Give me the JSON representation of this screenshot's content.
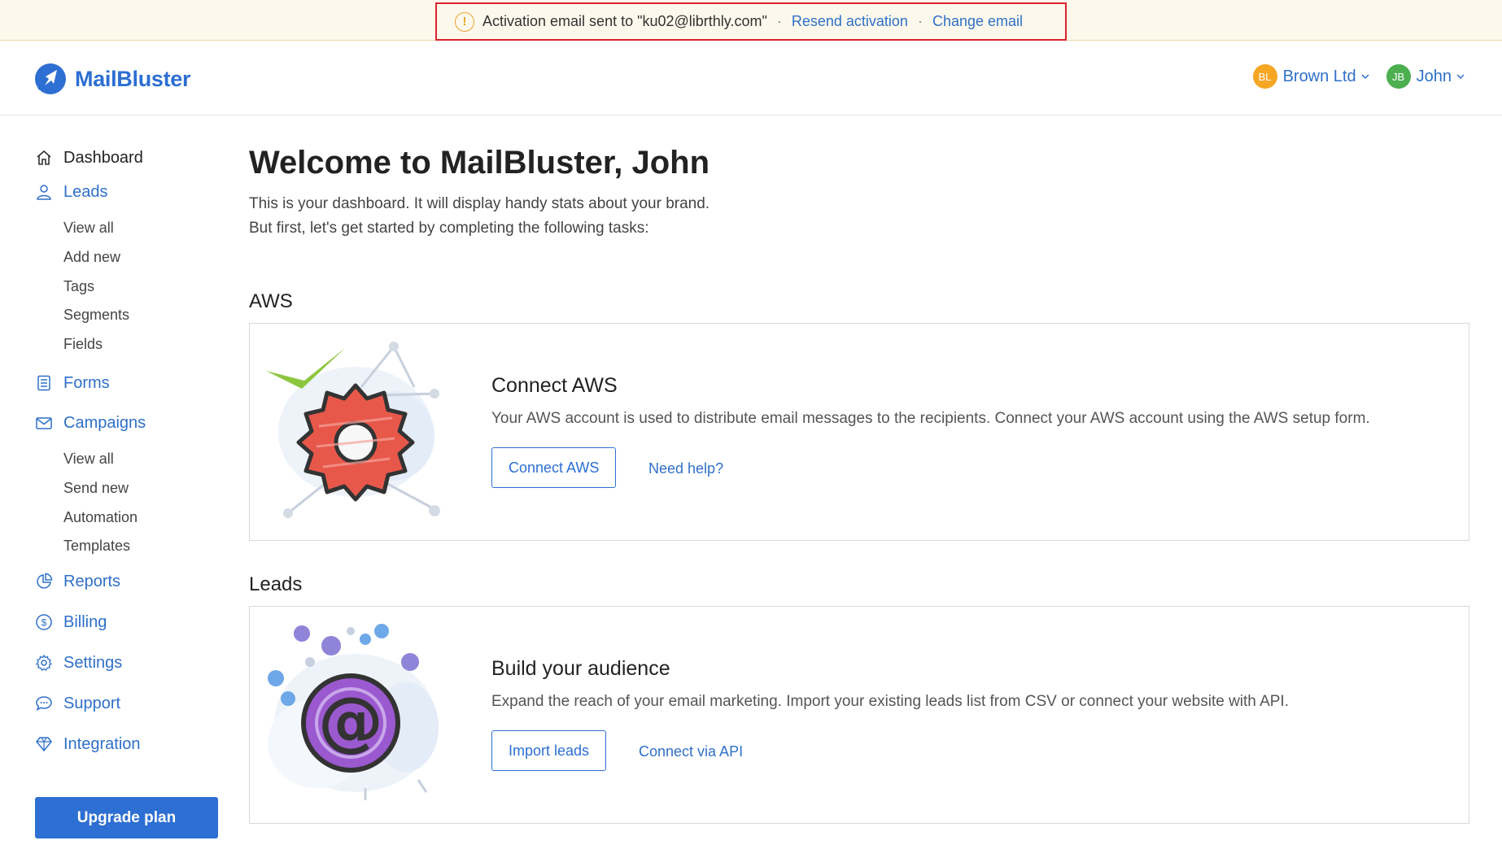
{
  "notice": {
    "text": "Activation email sent to \"ku02@librthly.com\"",
    "sep1": "·",
    "resend_label": "Resend activation",
    "sep2": "·",
    "change_label": "Change email"
  },
  "header": {
    "brand": "MailBluster",
    "brand_color": "#2d6fd2",
    "accounts": [
      {
        "initials": "BL",
        "name": "Brown Ltd",
        "color": "#f5a623"
      },
      {
        "initials": "JB",
        "name": "John",
        "color": "#4caf50"
      }
    ]
  },
  "sidebar": {
    "dashboard": "Dashboard",
    "leads": "Leads",
    "leads_sub": [
      "View all",
      "Add new",
      "Tags",
      "Segments",
      "Fields"
    ],
    "forms": "Forms",
    "campaigns": "Campaigns",
    "campaigns_sub": [
      "View all",
      "Send new",
      "Automation",
      "Templates"
    ],
    "reports": "Reports",
    "billing": "Billing",
    "settings": "Settings",
    "support": "Support",
    "integration": "Integration",
    "upgrade_label": "Upgrade plan"
  },
  "main": {
    "welcome": "Welcome to MailBluster, John",
    "intro_line1": "This is your dashboard. It will display handy stats about your brand.",
    "intro_line2": "But first, let's get started by completing the following tasks:",
    "sections": [
      {
        "heading": "AWS",
        "title": "Connect AWS",
        "desc": "Your AWS account is used to distribute email messages to the recipients. Connect your AWS account using the AWS setup form.",
        "button": "Connect AWS",
        "link": "Need help?"
      },
      {
        "heading": "Leads",
        "title": "Build your audience",
        "desc": "Expand the reach of your email marketing. Import your existing leads list from CSV or connect your website with API.",
        "button": "Import leads",
        "link": "Connect via API"
      }
    ]
  }
}
